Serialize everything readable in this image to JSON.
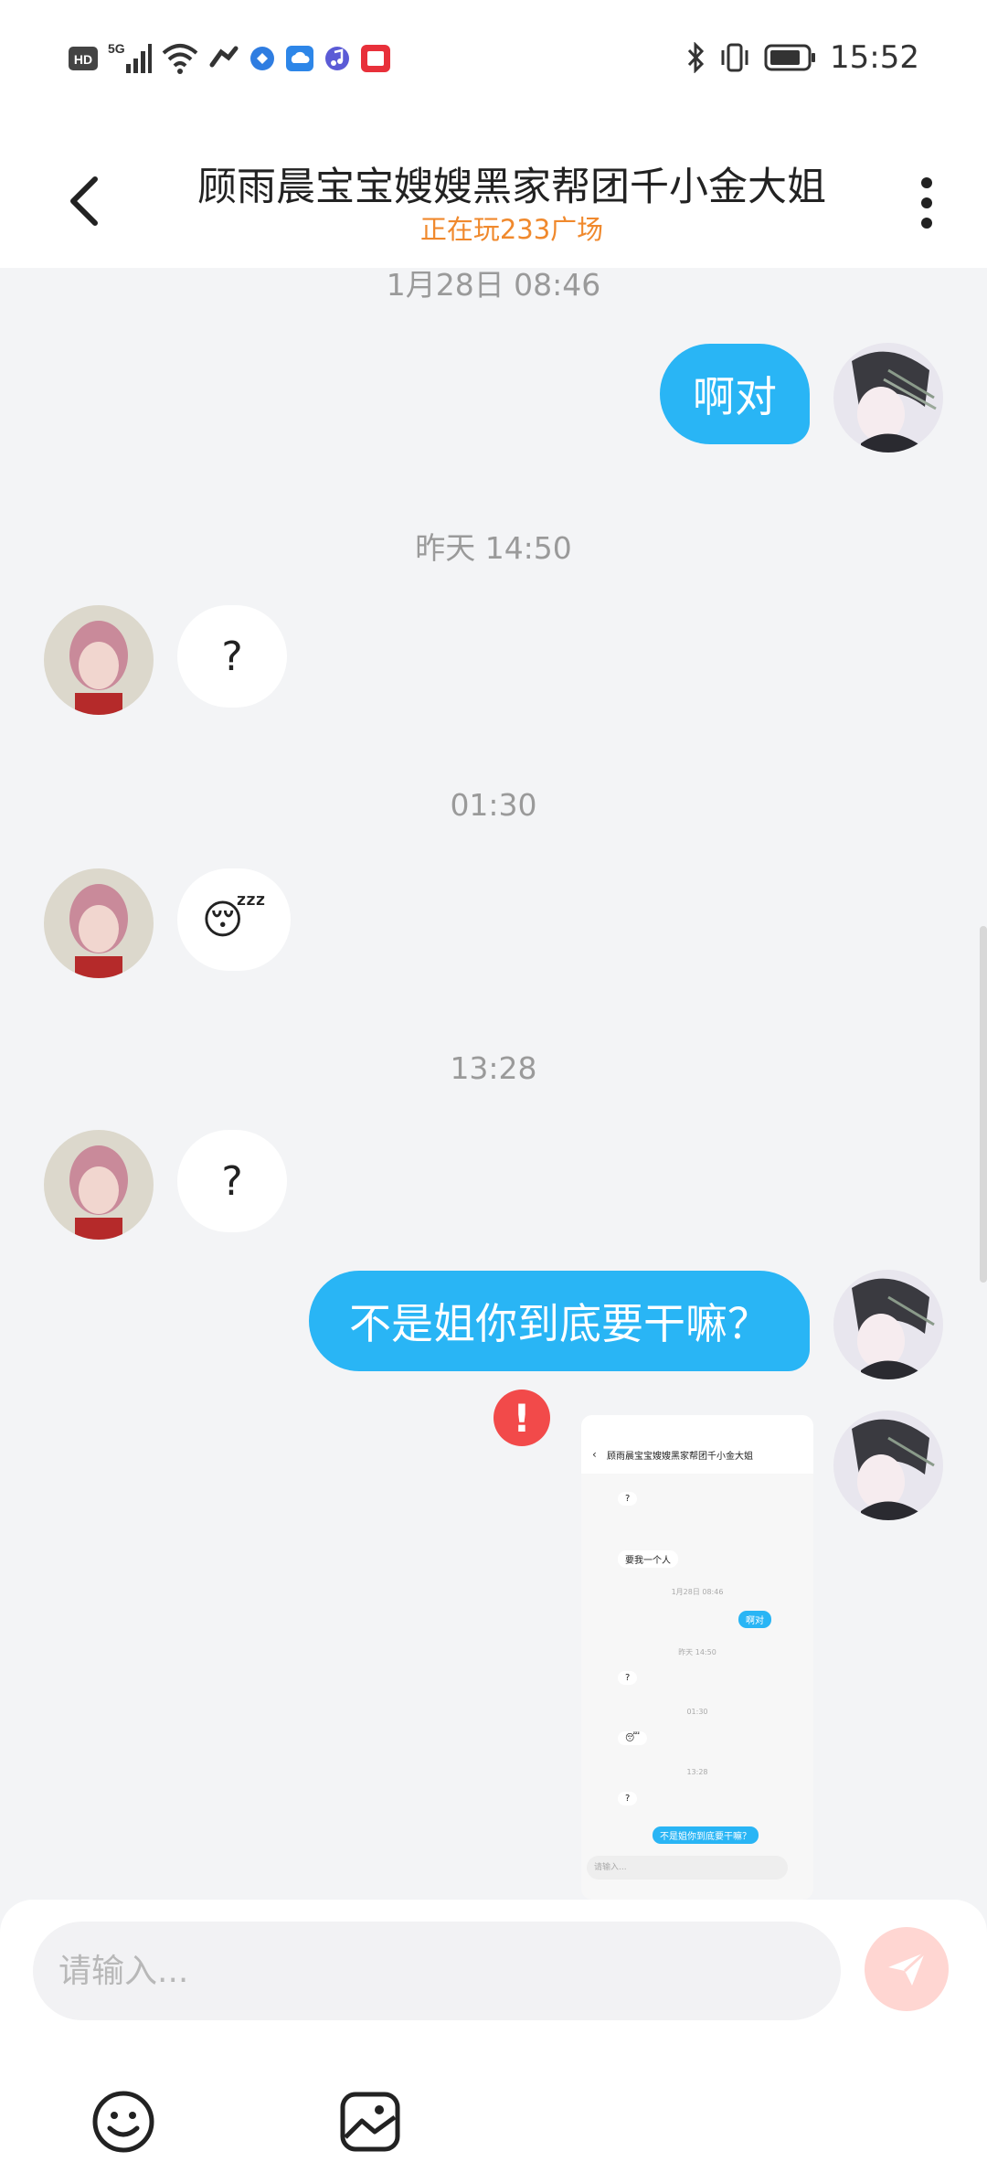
{
  "status_bar": {
    "time": "15:52",
    "left_icons": [
      "hd-icon",
      "5g-signal-icon",
      "wifi-icon",
      "link-icon",
      "app-icon",
      "cloud-icon",
      "music-icon",
      "book-icon"
    ],
    "right_icons": [
      "bluetooth-icon",
      "vibrate-icon",
      "battery-icon"
    ]
  },
  "header": {
    "title": "顾雨晨宝宝嫂嫂黑家帮团千小金大姐",
    "subtitle": "正在玩233广场",
    "subtitle_color": "#f0892d"
  },
  "chat": {
    "timestamps": [
      "1月28日 08:46",
      "昨天 14:50",
      "01:30",
      "13:28"
    ],
    "messages": [
      {
        "side": "out",
        "text": "啊对"
      },
      {
        "side": "in",
        "text": "?"
      },
      {
        "side": "in",
        "text": "😴"
      },
      {
        "side": "in",
        "text": "?"
      },
      {
        "side": "out",
        "text": "不是姐你到底要干嘛？"
      }
    ],
    "failed_indicator": "!",
    "accent": "#29b5f5"
  },
  "thumbnail": {
    "title": "顾雨晨宝宝嫂嫂黑家帮团千小金大姐",
    "rows": [
      "?",
      "要我一个人",
      "1月28日 08:46",
      "啊对",
      "昨天 14:50",
      "?",
      "01:30",
      "😴",
      "13:28",
      "?",
      "不是姐你到底要干嘛？"
    ],
    "input_placeholder": "请输入..."
  },
  "input": {
    "placeholder": "请输入...",
    "send_color": "#ffd6d2"
  }
}
